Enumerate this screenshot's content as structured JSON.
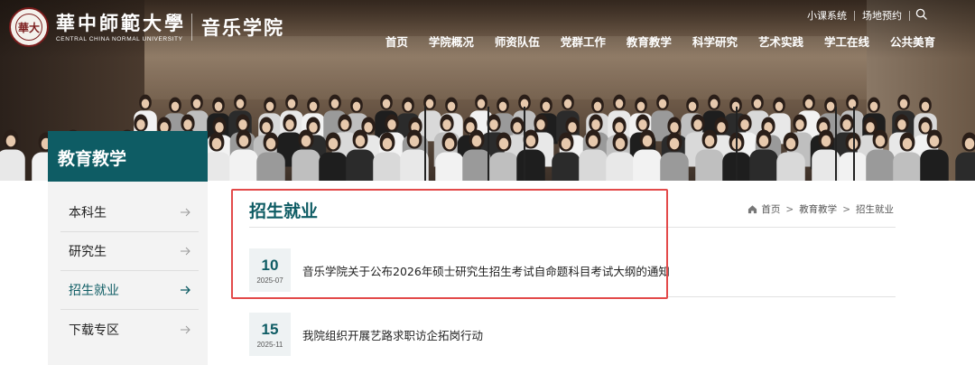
{
  "header": {
    "university_name_cn": "華中師範大學",
    "university_name_en": "CENTRAL CHINA NORMAL UNIVERSITY",
    "seal_text": "華大",
    "school_name": "音乐学院"
  },
  "utility_links": [
    "小课系统",
    "场地预约"
  ],
  "nav": [
    "首页",
    "学院概况",
    "师资队伍",
    "党群工作",
    "教育教学",
    "科学研究",
    "艺术实践",
    "学工在线",
    "公共美育"
  ],
  "sidebar": {
    "title": "教育教学",
    "items": [
      {
        "label": "本科生"
      },
      {
        "label": "研究生"
      },
      {
        "label": "招生就业"
      },
      {
        "label": "下载专区"
      }
    ],
    "active_index": 2
  },
  "content": {
    "title": "招生就业",
    "breadcrumb": [
      "首页",
      "教育教学",
      "招生就业"
    ],
    "news": [
      {
        "day": "10",
        "year_month": "2025-07",
        "title": "音乐学院关于公布2026年硕士研究生招生考试自命题科目考试大纲的通知"
      },
      {
        "day": "15",
        "year_month": "2025-11",
        "title": "我院组织开展艺路求职访企拓岗行动"
      }
    ]
  },
  "colors": {
    "brand_teal": "#0e5c64",
    "highlight_red": "#e34a4a",
    "sidebar_bg": "#f3f3f3",
    "date_bg": "#eef2f3"
  }
}
